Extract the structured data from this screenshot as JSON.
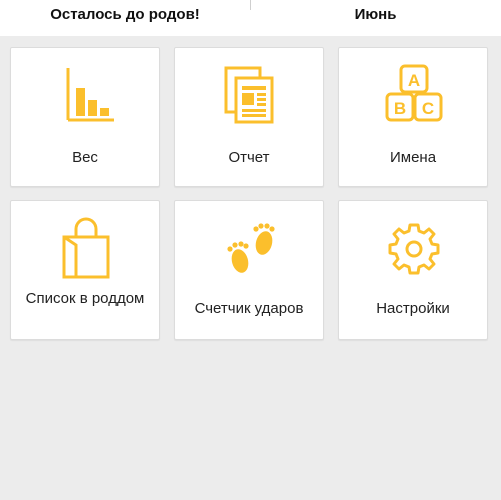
{
  "header": {
    "left_title": "Осталось до родов!",
    "right_title": "Июнь"
  },
  "colors": {
    "accent": "#fbbf2c",
    "background": "#ececec",
    "tile": "#ffffff"
  },
  "tiles": [
    {
      "label": "Вес",
      "icon": "bar-chart-icon"
    },
    {
      "label": "Отчет",
      "icon": "report-document-icon"
    },
    {
      "label": "Имена",
      "icon": "abc-blocks-icon"
    },
    {
      "label": "Список в роддом",
      "icon": "shopping-bag-icon"
    },
    {
      "label": "Счетчик ударов",
      "icon": "footprints-icon"
    },
    {
      "label": "Настройки",
      "icon": "gear-icon"
    }
  ]
}
